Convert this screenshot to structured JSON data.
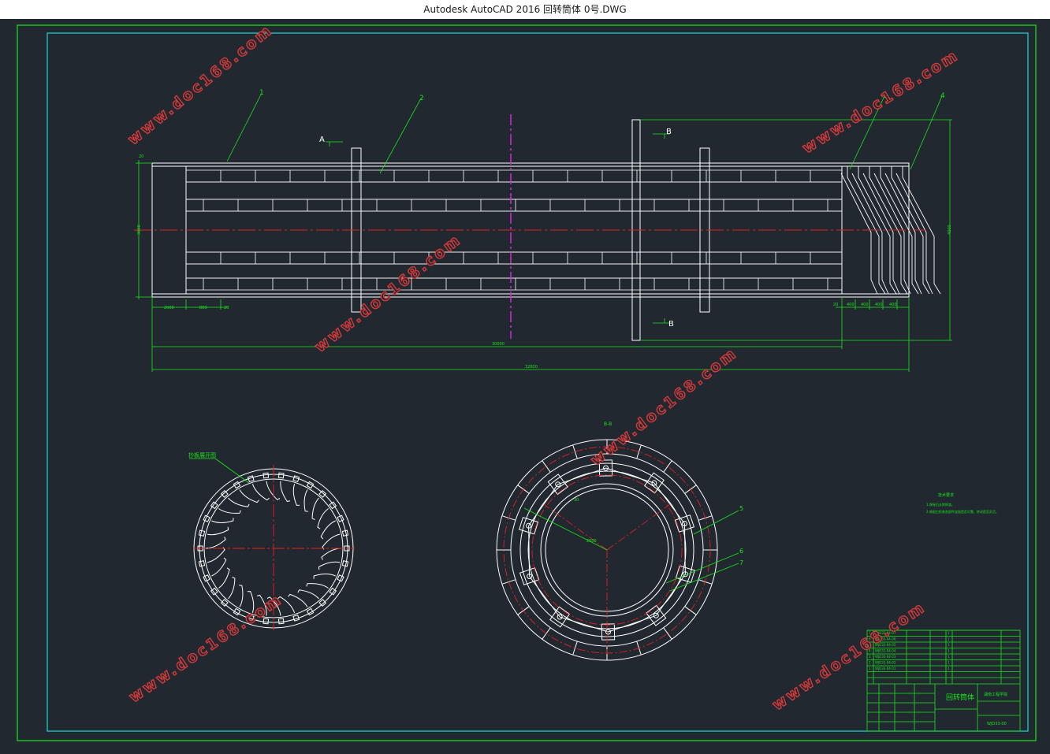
{
  "window": {
    "title": "Autodesk AutoCAD 2016     回转筒体 0号.DWG"
  },
  "watermark": {
    "text": "www.doc168.com"
  },
  "drawing": {
    "section_labels": {
      "a": "A",
      "b1": "B",
      "b2": "B"
    },
    "part_numbers": [
      "1",
      "2",
      "3",
      "4",
      "5",
      "6",
      "7"
    ],
    "dimensions": {
      "total_length": "32800",
      "body_length": "30000",
      "left_segments": [
        "2000",
        "800",
        "20"
      ],
      "right_segments": [
        "20",
        "400",
        "400",
        "400",
        "400"
      ],
      "diameter_left": "3000",
      "diameter_right": "4000",
      "left_top": "20",
      "angle_a": "30",
      "radius_b": "2000"
    },
    "view_labels": {
      "left_view": "抄板展开图",
      "right_view": "B-B"
    },
    "notes": {
      "title": "技术要求",
      "lines": [
        "1.焊接后去除焊渣。",
        "2.装配后检查各部件连接是否可靠，转动是否灵活。"
      ]
    }
  },
  "title_block": {
    "drawing_name": "回转筒体",
    "drawing_no": "WJD33-00",
    "company": "湖南工程学院",
    "bom_rows": [
      {
        "no": "7",
        "code": "WJD33-04-07",
        "qty": "1"
      },
      {
        "no": "6",
        "code": "WJD33-04-06",
        "qty": "1"
      },
      {
        "no": "5",
        "code": "WJD33-04-05",
        "qty": "1"
      },
      {
        "no": "4",
        "code": "WJD33-04-04",
        "qty": "1"
      },
      {
        "no": "3",
        "code": "WJD33-04-03",
        "qty": "1"
      },
      {
        "no": "2",
        "code": "WJD33-04-02",
        "qty": "1"
      },
      {
        "no": "1",
        "code": "WJD33-04-01",
        "qty": "1"
      }
    ]
  },
  "colors": {
    "background": "#212830",
    "white_lines": "#ffffff",
    "green_lines": "#19e619",
    "red_center": "#e02020",
    "magenta": "#d12bd1",
    "cyan_border": "#19d8d8"
  }
}
